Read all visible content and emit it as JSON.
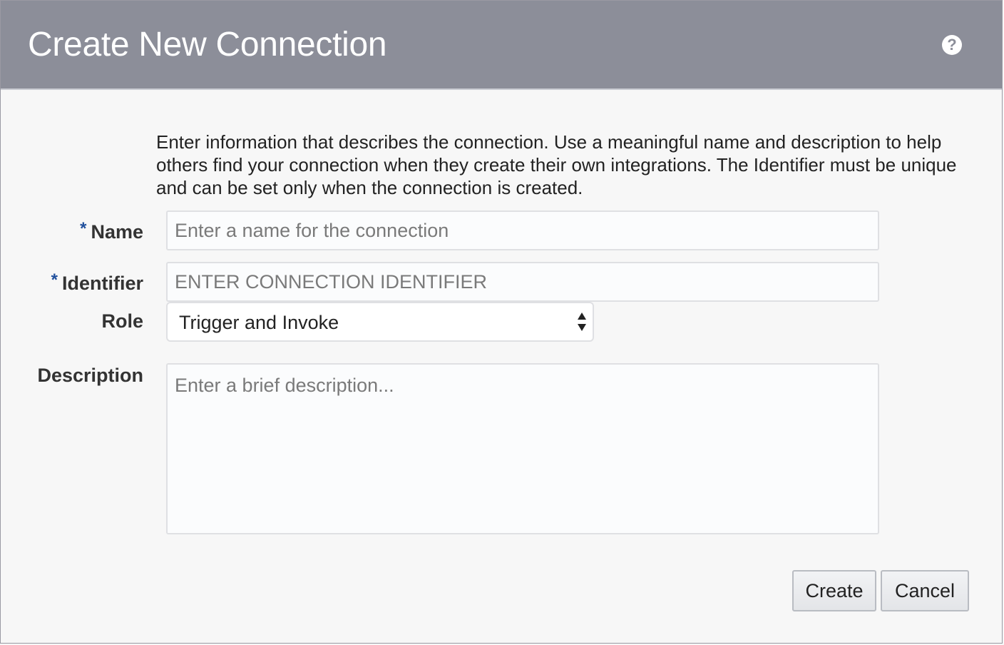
{
  "dialog": {
    "title": "Create New Connection",
    "help_icon": "question-circle-icon",
    "header_color": "#8c8e99"
  },
  "intro_text": "Enter information that describes the connection. Use a meaningful name and description to help others find your connection when they create their own integrations. The Identifier must be unique and can be set only when the connection is created.",
  "form": {
    "required_marker": "*",
    "required_marker_color": "#1f4f9c",
    "name": {
      "label": "Name",
      "value": "",
      "placeholder": "Enter a name for the connection"
    },
    "identifier": {
      "label": "Identifier",
      "value": "",
      "placeholder": "ENTER CONNECTION IDENTIFIER"
    },
    "role": {
      "label": "Role",
      "selected": "Trigger and Invoke"
    },
    "description": {
      "label": "Description",
      "value": "",
      "placeholder": "Enter a brief description..."
    }
  },
  "buttons": {
    "create_label": "Create",
    "cancel_label": "Cancel"
  }
}
